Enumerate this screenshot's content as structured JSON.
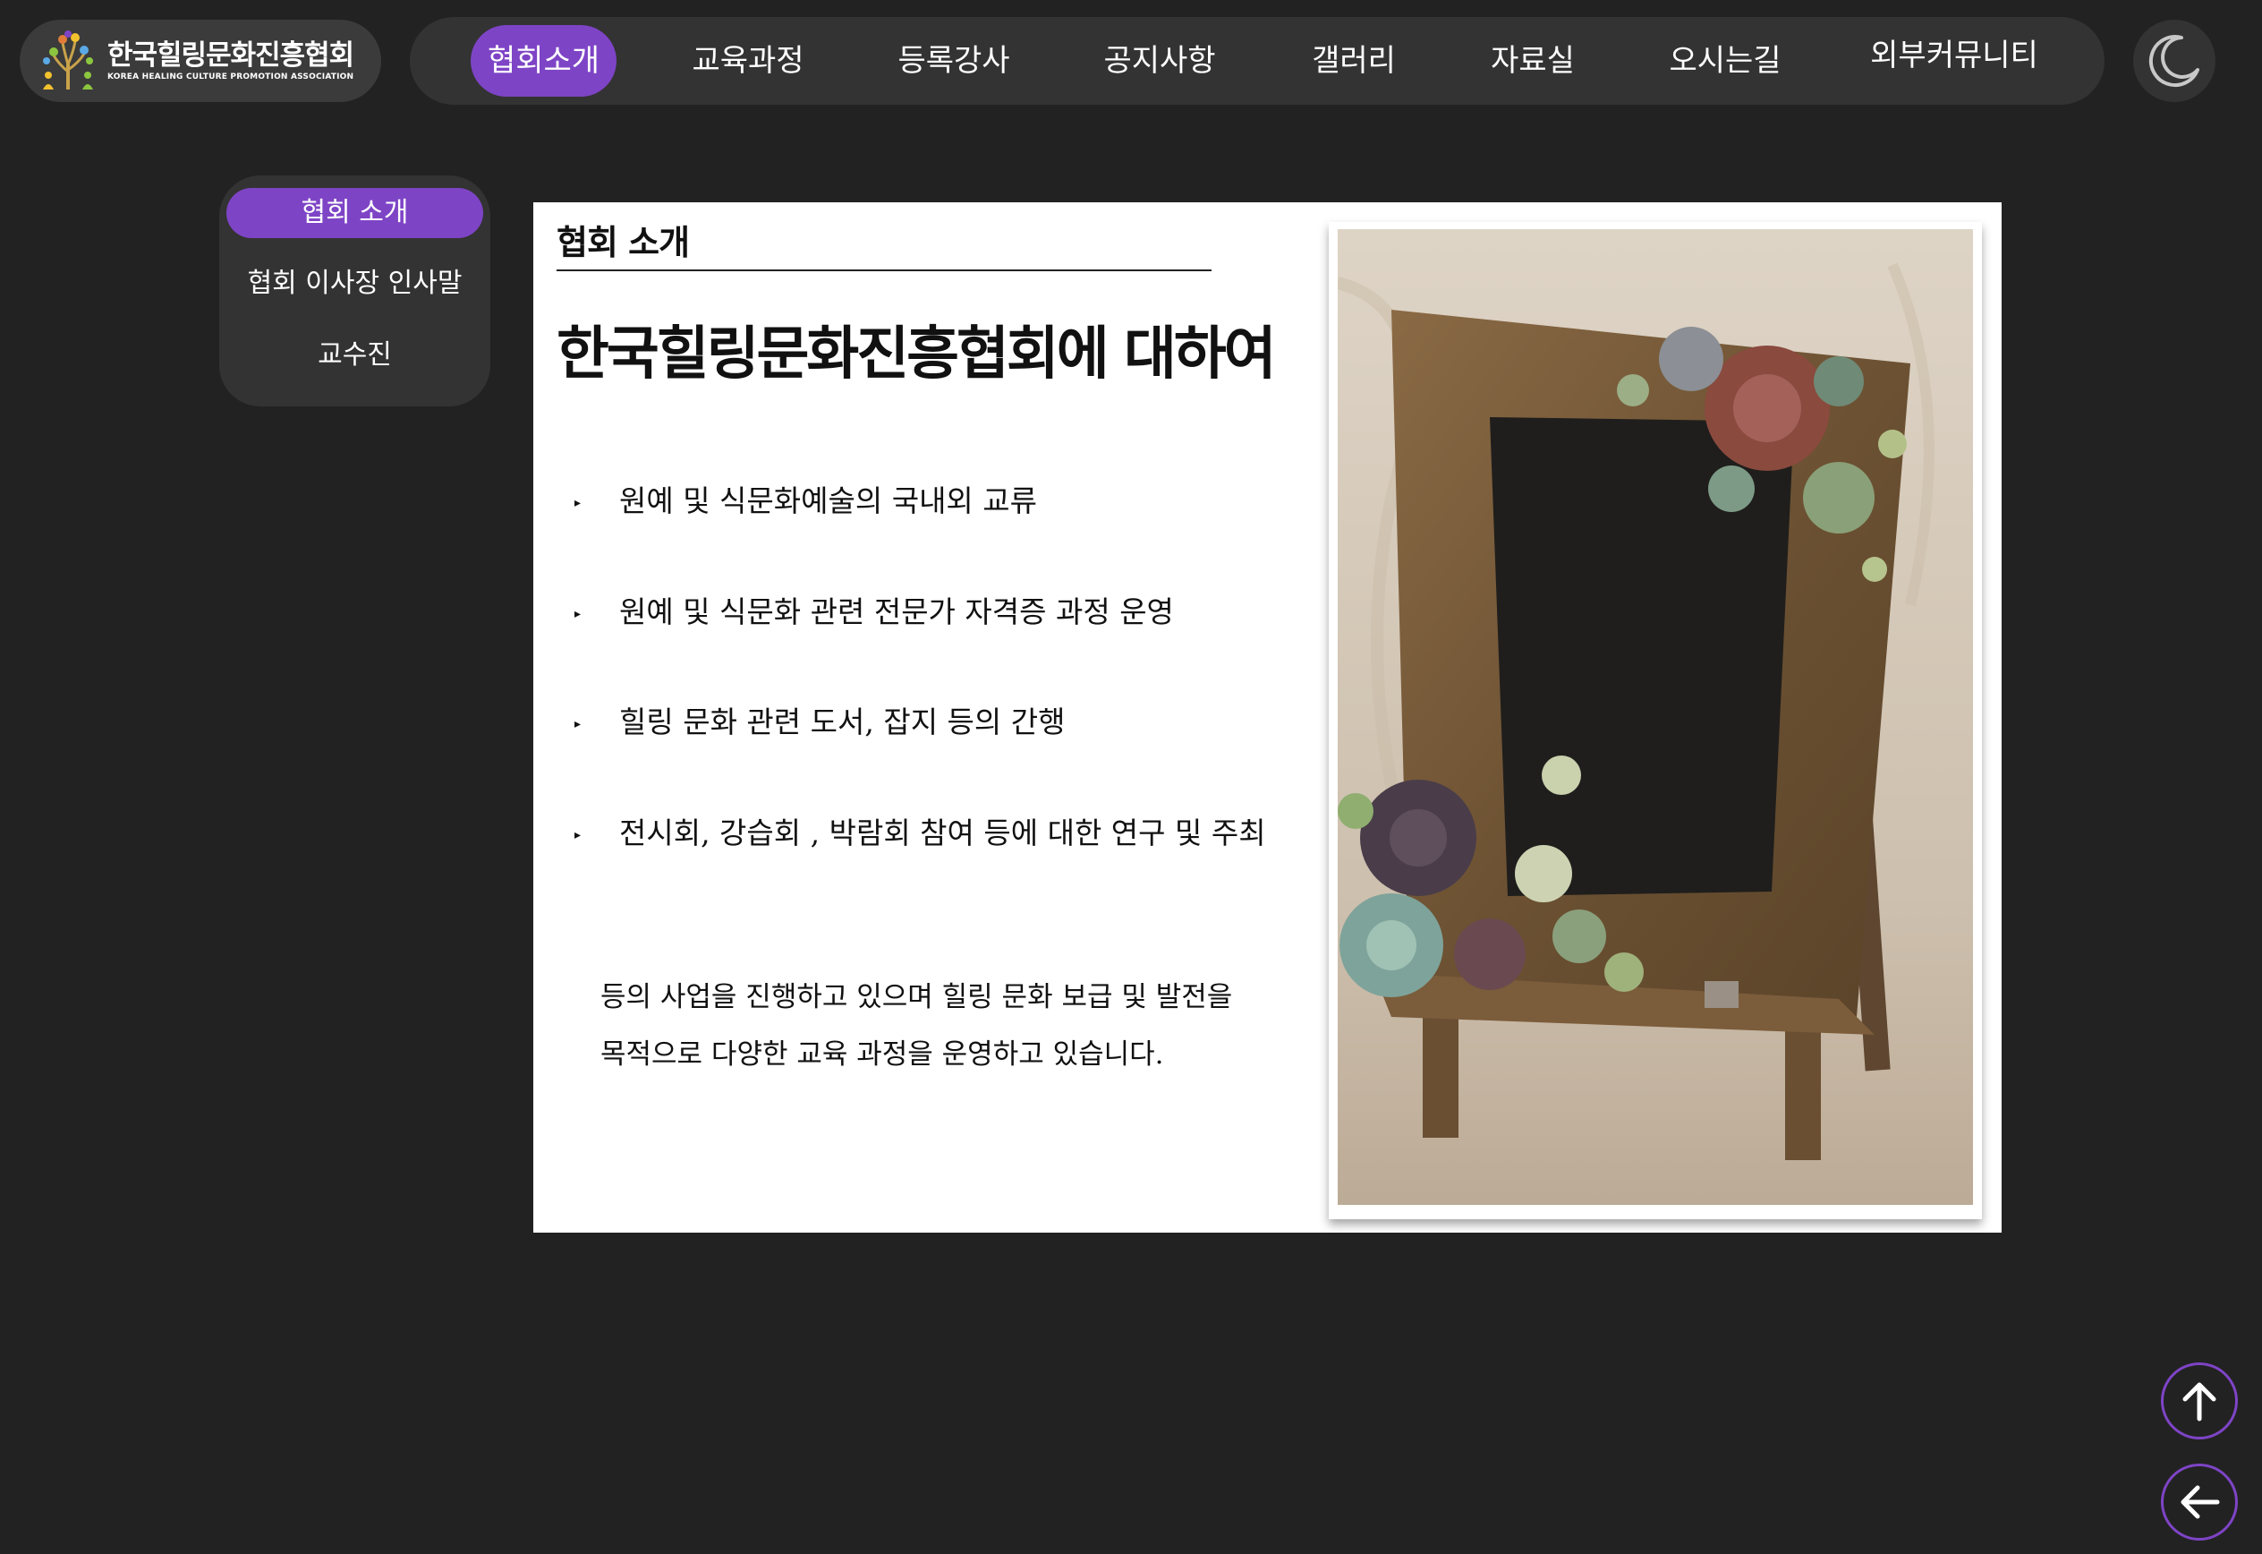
{
  "logo": {
    "name_ko": "한국힐링문화진흥협회",
    "name_en": "KOREA HEALING CULTURE PROMOTION ASSOCIATION",
    "icon": "tree-people-icon"
  },
  "nav": {
    "items": [
      {
        "label": "협회소개",
        "active": true
      },
      {
        "label": "교육과정",
        "active": false
      },
      {
        "label": "등록강사",
        "active": false
      },
      {
        "label": "공지사항",
        "active": false
      },
      {
        "label": "갤러리",
        "active": false
      },
      {
        "label": "자료실",
        "active": false
      },
      {
        "label": "오시는길",
        "active": false
      },
      {
        "label": "외부커뮤니티",
        "active": false
      }
    ],
    "theme_toggle_icon": "moon-icon"
  },
  "sidebar": {
    "items": [
      {
        "label": "협회 소개",
        "active": true
      },
      {
        "label": "협회 이사장 인사말",
        "active": false
      },
      {
        "label": "교수진",
        "active": false
      }
    ]
  },
  "main": {
    "section_title": "협회 소개",
    "headline": "한국힐링문화진흥협회에 대하여",
    "bullets": [
      "원예 및 식문화예술의 국내외 교류",
      "원예 및 식문화 관련 전문가 자격증 과정 운영",
      "힐링 문화 관련 도서, 잡지 등의 간행",
      "전시회, 강습회 , 박람회 참여 등에 대한 연구 및 주최"
    ],
    "paragraph_lines": [
      "등의 사업을 진행하고 있으며 힐링 문화 보급 및 발전을",
      "목적으로 다양한 교육 과정을 운영하고 있습니다."
    ],
    "photo_icon": "chalkboard-succulent-photo"
  },
  "floating": {
    "up_icon": "arrow-up-icon",
    "back_icon": "arrow-left-icon"
  },
  "colors": {
    "background": "#222222",
    "panel": "#333333",
    "accent": "#7e44c6",
    "card": "#ffffff"
  }
}
